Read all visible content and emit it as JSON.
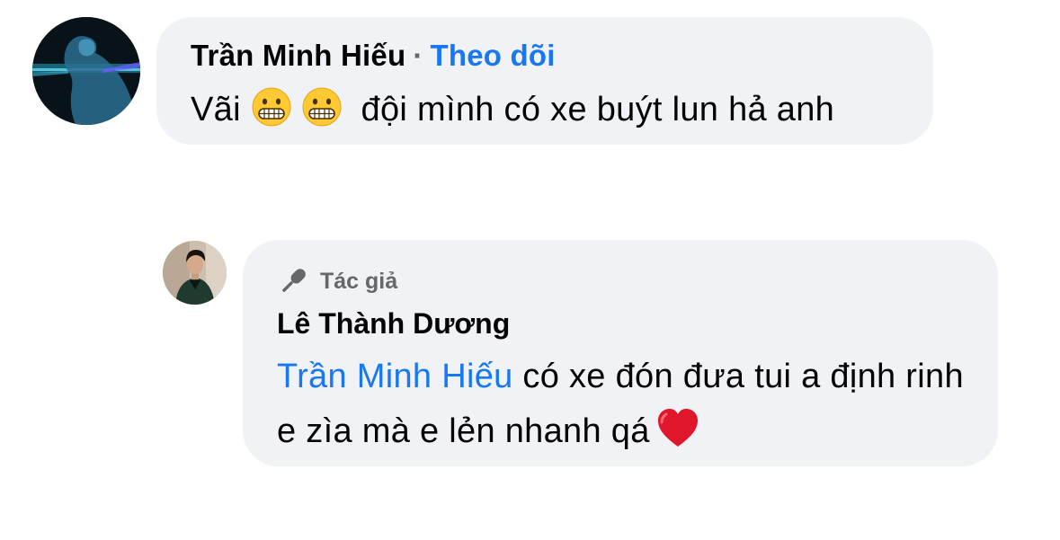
{
  "comment": {
    "author": "Trần Minh Hiếu",
    "separator": "·",
    "follow_label": "Theo dõi",
    "text_prefix": "Vãi",
    "emojis": [
      "grimacing-face",
      "grimacing-face"
    ],
    "text_suffix": "đội mình có xe buýt lun hả anh"
  },
  "reply": {
    "badge_icon": "microphone-icon",
    "badge_label": "Tác giả",
    "author": "Lê Thành Dương",
    "mention": "Trần Minh Hiếu",
    "text": " có xe đón đưa tui a định rinh e zìa mà e lẻn nhanh qá",
    "trailing_emoji": "red-heart"
  },
  "colors": {
    "bubble_bg": "#f0f2f5",
    "link_blue": "#1877f2",
    "muted_gray": "#65676b",
    "text_dark": "#050505",
    "heart_red": "#e0162b",
    "emoji_yellow": "#ffc933"
  }
}
